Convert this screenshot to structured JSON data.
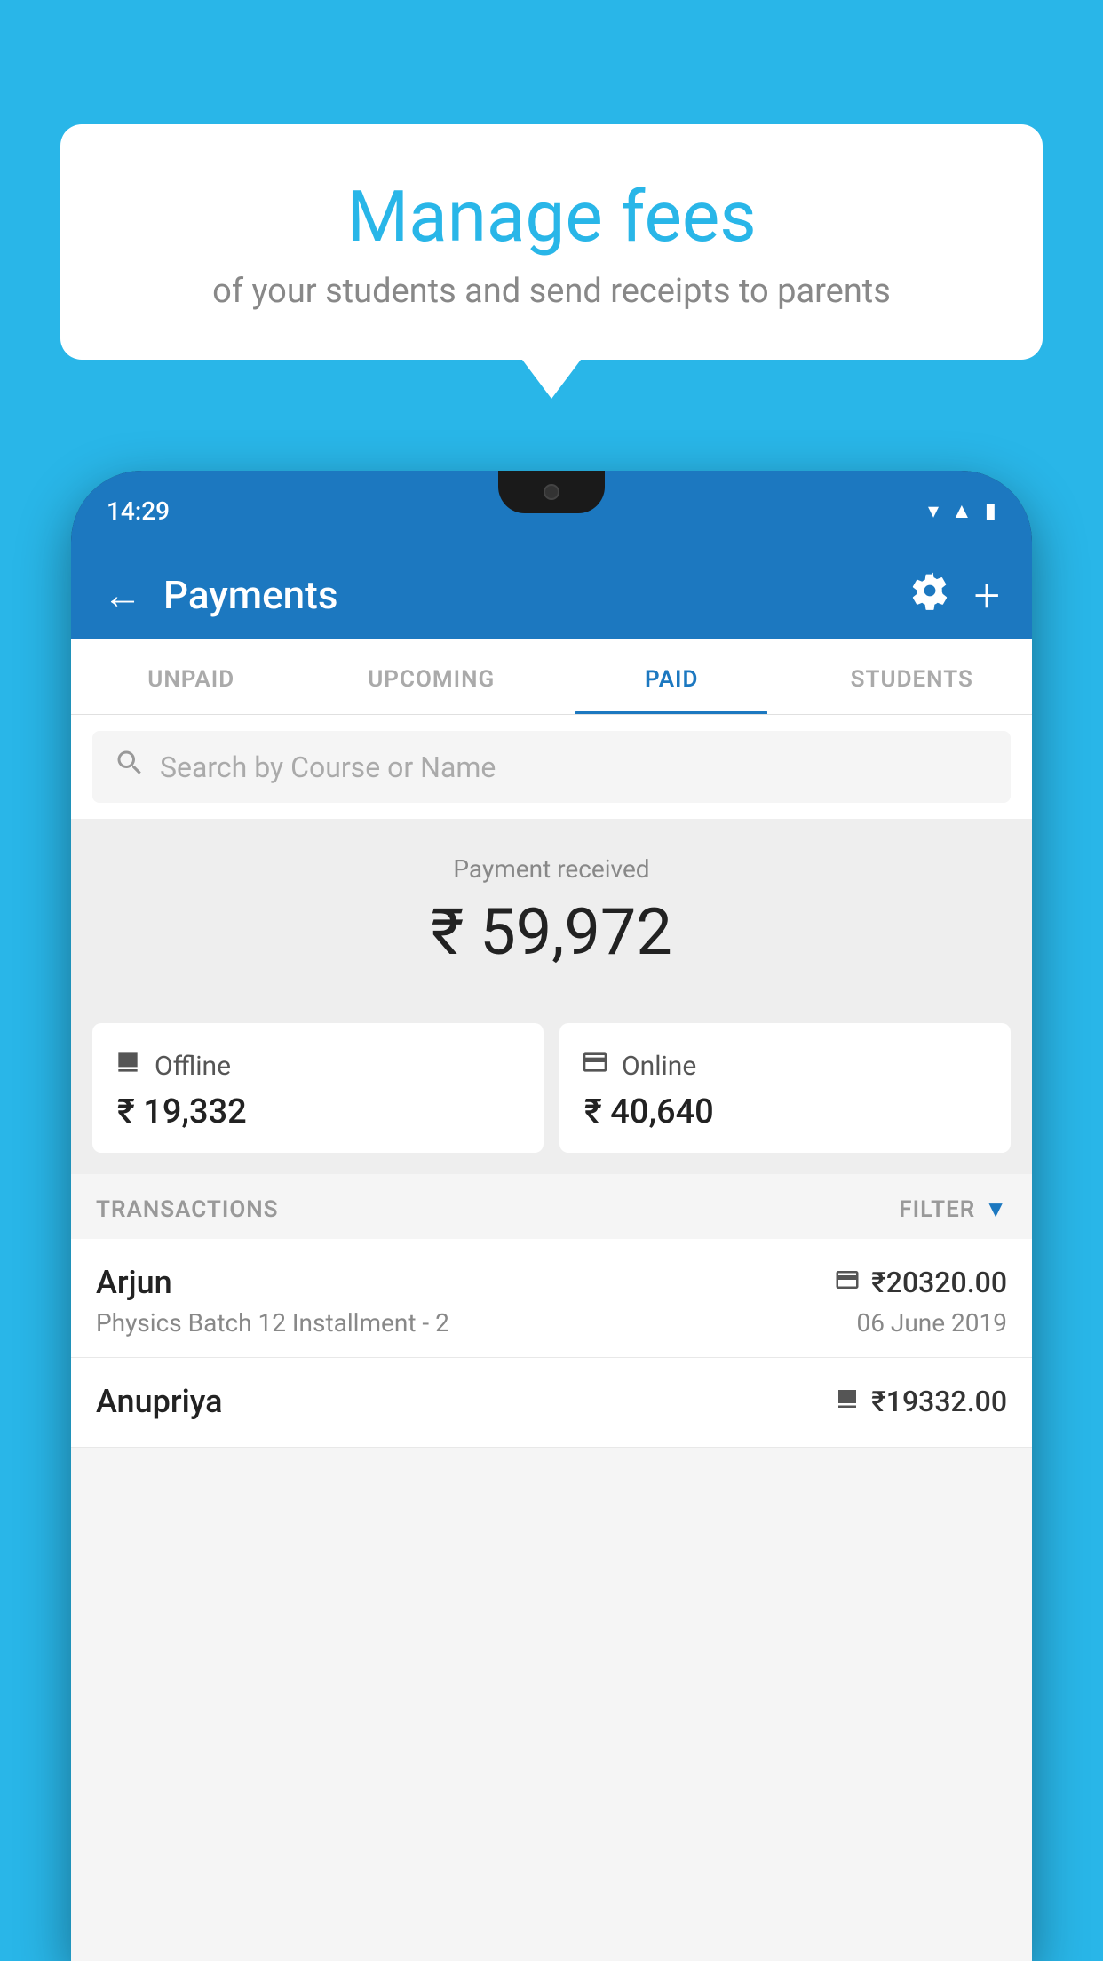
{
  "background_color": "#29b6e8",
  "bubble": {
    "title": "Manage fees",
    "subtitle": "of your students and send receipts to parents"
  },
  "status_bar": {
    "time": "14:29"
  },
  "header": {
    "title": "Payments",
    "back_label": "←",
    "settings_label": "⚙",
    "add_label": "+"
  },
  "tabs": [
    {
      "id": "unpaid",
      "label": "UNPAID",
      "active": false
    },
    {
      "id": "upcoming",
      "label": "UPCOMING",
      "active": false
    },
    {
      "id": "paid",
      "label": "PAID",
      "active": true
    },
    {
      "id": "students",
      "label": "STUDENTS",
      "active": false
    }
  ],
  "search": {
    "placeholder": "Search by Course or Name"
  },
  "payment": {
    "label": "Payment received",
    "amount": "₹ 59,972",
    "offline": {
      "label": "Offline",
      "amount": "₹ 19,332"
    },
    "online": {
      "label": "Online",
      "amount": "₹ 40,640"
    }
  },
  "transactions": {
    "header": "TRANSACTIONS",
    "filter_label": "FILTER",
    "rows": [
      {
        "name": "Arjun",
        "course": "Physics Batch 12 Installment - 2",
        "amount": "₹20320.00",
        "date": "06 June 2019",
        "payment_type": "online"
      },
      {
        "name": "Anupriya",
        "course": "",
        "amount": "₹19332.00",
        "date": "",
        "payment_type": "offline"
      }
    ]
  }
}
